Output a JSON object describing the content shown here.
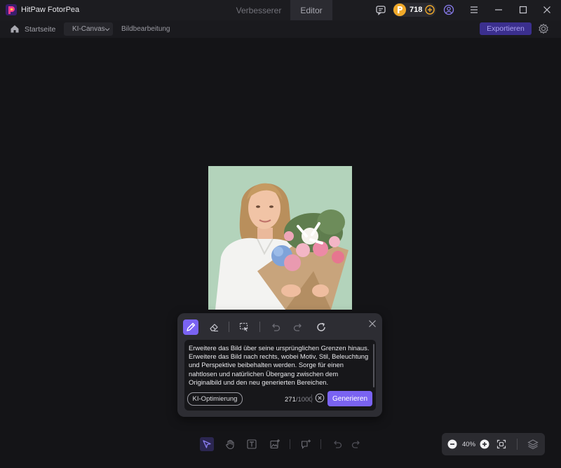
{
  "app": {
    "name": "HitPaw FotorPea"
  },
  "mode_tabs": [
    {
      "label": "Verbesserer",
      "active": false
    },
    {
      "label": "Editor",
      "active": true
    }
  ],
  "titlebar": {
    "credits": "718",
    "icons": [
      "chat-icon",
      "coin-icon",
      "add-credits-icon",
      "user-icon",
      "menu-icon",
      "minimize-icon",
      "maximize-icon",
      "close-icon"
    ]
  },
  "navbar": {
    "home_label": "Startseite",
    "dropdown_label": "KI-Canvas",
    "crumb_label": "Bildbearbeitung",
    "export_label": "Exportieren"
  },
  "prompt_panel": {
    "tools": [
      "brush-icon",
      "eraser-icon",
      "selection-icon",
      "undo-icon",
      "redo-icon",
      "reset-icon"
    ],
    "prompt_text": "Erweitere das Bild über seine ursprünglichen Grenzen hinaus. Erweitere das Bild nach rechts, wobei Motiv, Stil, Beleuchtung und Perspektive beibehalten werden. Sorge für einen nahtlosen und natürlichen Übergang zwischen dem Originalbild und den neu generierten Bereichen.",
    "ai_optimize_label": "KI-Optimierung",
    "char_count": "271",
    "char_max": "/1000",
    "generate_label": "Generieren"
  },
  "bottom_toolbar": {
    "tools": [
      "select-icon",
      "hand-icon",
      "text-icon",
      "add-image-icon",
      "chat-add-icon",
      "undo-icon",
      "redo-icon"
    ]
  },
  "zoom": {
    "value": "40%"
  },
  "colors": {
    "accent": "#7a63f2",
    "background": "#151518",
    "panel": "#2d2d33",
    "coin": "#f0a92a"
  }
}
